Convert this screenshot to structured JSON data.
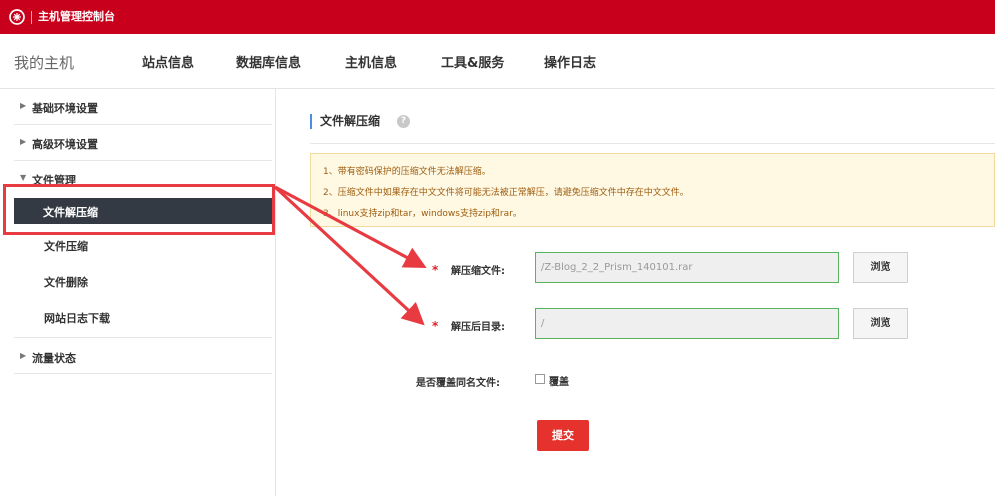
{
  "header": {
    "app_title": "主机管理控制台"
  },
  "nav": {
    "home": "我的主机",
    "items": [
      "站点信息",
      "数据库信息",
      "主机信息",
      "工具&服务",
      "操作日志"
    ]
  },
  "sidebar": {
    "groups": [
      {
        "label": "基础环境设置",
        "expanded": false
      },
      {
        "label": "高级环境设置",
        "expanded": false
      },
      {
        "label": "文件管理",
        "expanded": true,
        "items": [
          "文件解压缩",
          "文件压缩",
          "文件删除",
          "网站日志下载"
        ],
        "active": "文件解压缩"
      },
      {
        "label": "流量状态",
        "expanded": false
      }
    ]
  },
  "panel": {
    "title": "文件解压缩",
    "help_icon": "question-circle-icon",
    "notices": [
      "1、带有密码保护的压缩文件无法解压缩。",
      "2、压缩文件中如果存在中文文件将可能无法被正常解压，请避免压缩文件中存在中文文件。",
      "3、linux支持zip和tar，windows支持zip和rar。"
    ]
  },
  "form": {
    "required_mark": "*",
    "archive_label": "解压缩文件:",
    "archive_value": "/Z-Blog_2_2_Prism_140101.rar",
    "target_label": "解压后目录:",
    "target_value": "/",
    "browse_label": "浏览",
    "overwrite_label": "是否覆盖同名文件:",
    "overwrite_checkbox_label": "覆盖",
    "overwrite_checked": false,
    "submit_label": "提交"
  },
  "colors": {
    "brand": "#c9001c",
    "sidebar_active": "#333a44",
    "submit": "#e5322d",
    "highlight": "#e83b41"
  }
}
